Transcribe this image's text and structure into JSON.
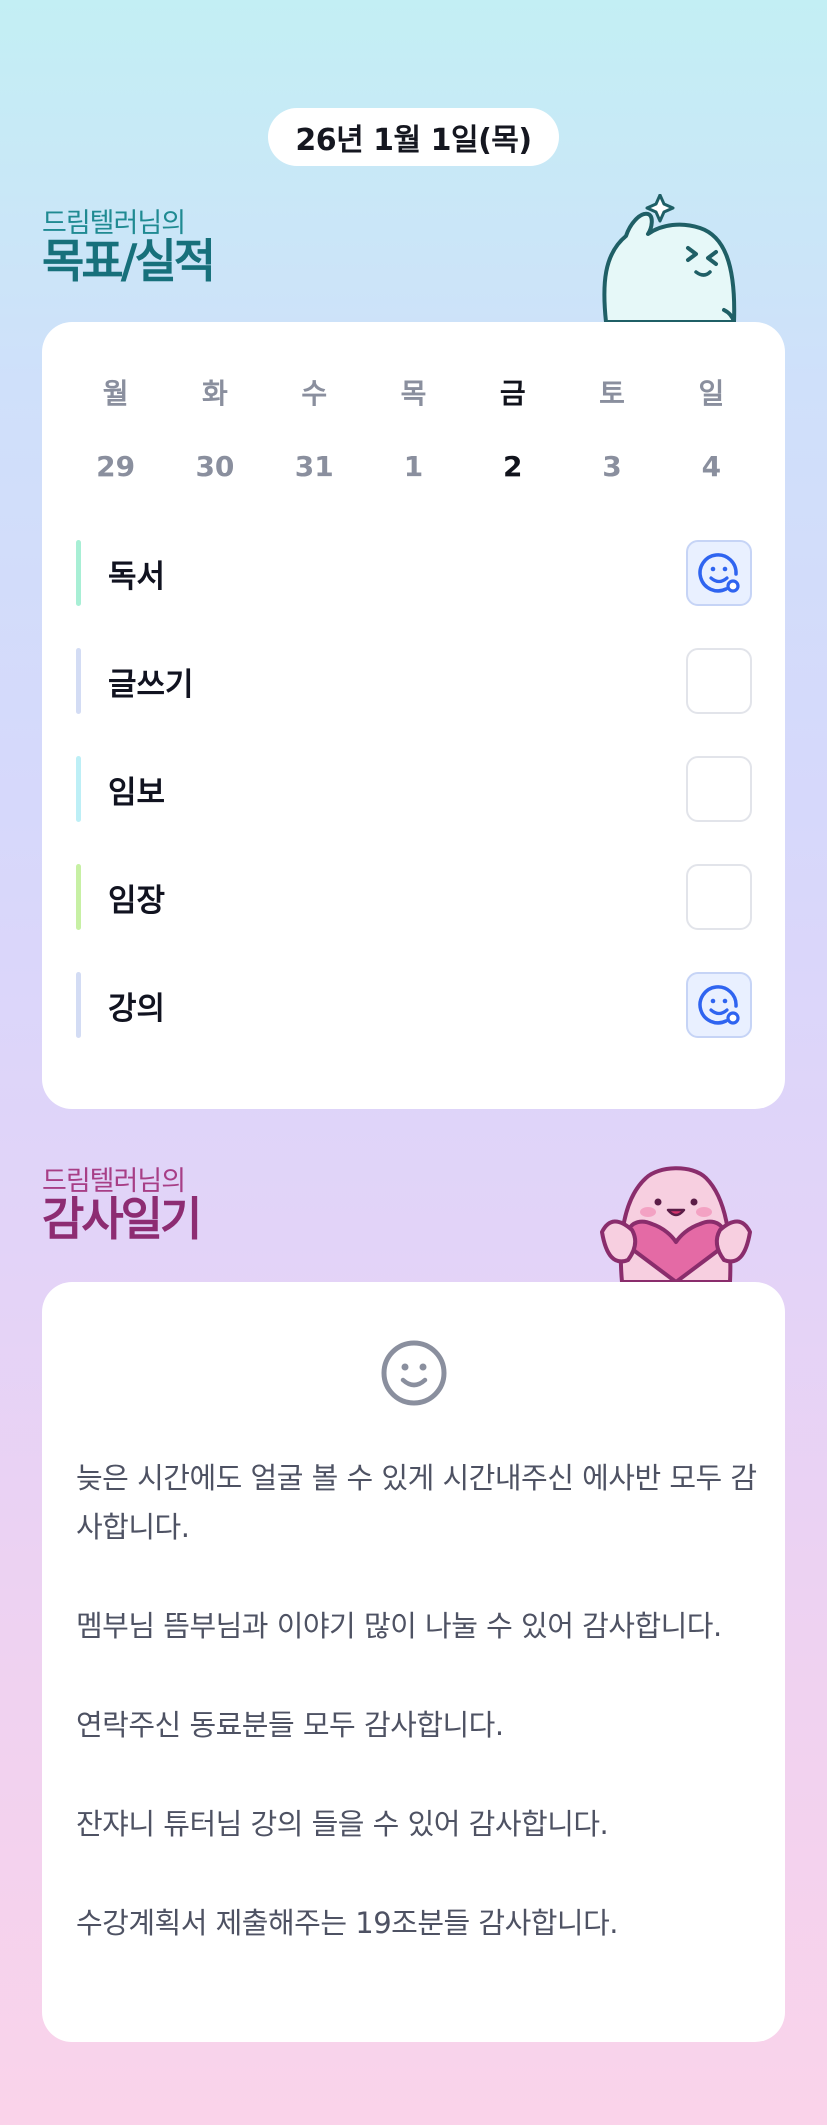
{
  "date": "26년 1월 1일(목)",
  "goals": {
    "subtitle": "드림텔러님의",
    "title": "목표/실적"
  },
  "week": {
    "days": [
      "월",
      "화",
      "수",
      "목",
      "금",
      "토",
      "일"
    ],
    "dates": [
      "29",
      "30",
      "31",
      "1",
      "2",
      "3",
      "4"
    ],
    "active_index": 4
  },
  "habits": [
    {
      "label": "독서",
      "bar_color": "#a8efd5",
      "done": true
    },
    {
      "label": "글쓰기",
      "bar_color": "#d3dcf4",
      "done": false
    },
    {
      "label": "임보",
      "bar_color": "#bdeff6",
      "done": false
    },
    {
      "label": "임장",
      "bar_color": "#c7f0a4",
      "done": false
    },
    {
      "label": "강의",
      "bar_color": "#d3dcf4",
      "done": true
    }
  ],
  "thanks": {
    "subtitle": "드림텔러님의",
    "title": "감사일기",
    "paragraphs": [
      "늦은 시간에도 얼굴 볼 수 있게 시간내주신 에사반 모두 감사합니다.",
      "멤부님 뜸부님과 이야기 많이 나눌 수 있어 감사합니다.",
      "연락주신 동료분들 모두 감사합니다.",
      "잔쟈니 튜터님 강의 들을 수 있어 감사합니다.",
      "수강계획서 제출해주는 19조분들 감사합니다."
    ]
  },
  "icons": {
    "check_done": "smile-check-icon",
    "mood": "smile-face-icon",
    "goal_mascot": "ghost-mascot-icon",
    "thanks_mascot": "heart-mascot-icon"
  },
  "colors": {
    "goal_title": "#17707b",
    "thanks_title": "#8d2c72",
    "check_blue": "#2f64f0"
  }
}
